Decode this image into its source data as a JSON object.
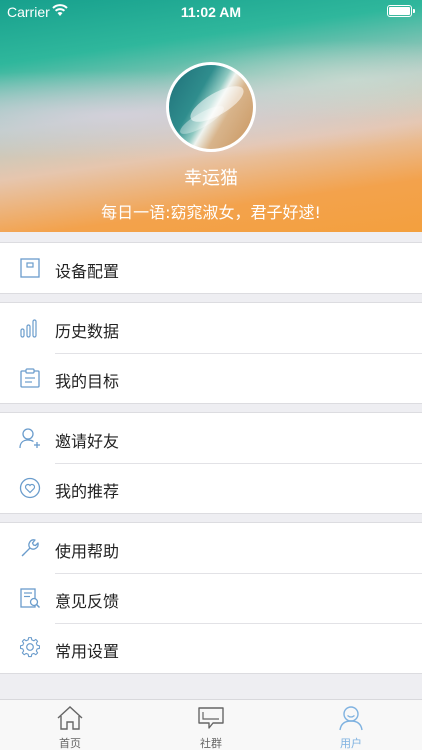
{
  "status_bar": {
    "carrier": "Carrier",
    "time": "11:02 AM"
  },
  "profile": {
    "name": "幸运猫",
    "motto": "每日一语:窈窕淑女，君子好逑!"
  },
  "menu": {
    "group1": [
      {
        "label": "设备配置",
        "icon": "device-config-icon"
      }
    ],
    "group2": [
      {
        "label": "历史数据",
        "icon": "bar-chart-icon"
      },
      {
        "label": "我的目标",
        "icon": "clipboard-icon"
      }
    ],
    "group3": [
      {
        "label": "邀请好友",
        "icon": "add-user-icon"
      },
      {
        "label": "我的推荐",
        "icon": "heart-circle-icon"
      }
    ],
    "group4": [
      {
        "label": "使用帮助",
        "icon": "wrench-icon"
      },
      {
        "label": "意见反馈",
        "icon": "feedback-doc-icon"
      },
      {
        "label": "常用设置",
        "icon": "gear-icon"
      }
    ]
  },
  "tabbar": [
    {
      "label": "首页",
      "icon": "home-icon",
      "active": false
    },
    {
      "label": "社群",
      "icon": "chat-bubble-icon",
      "active": false
    },
    {
      "label": "用户",
      "icon": "user-icon",
      "active": true
    }
  ],
  "colors": {
    "icon_blue": "#6a9ccc",
    "active_tab": "#7fb2e0",
    "header_top": "#17a08d",
    "header_bottom": "#f3a03e"
  }
}
